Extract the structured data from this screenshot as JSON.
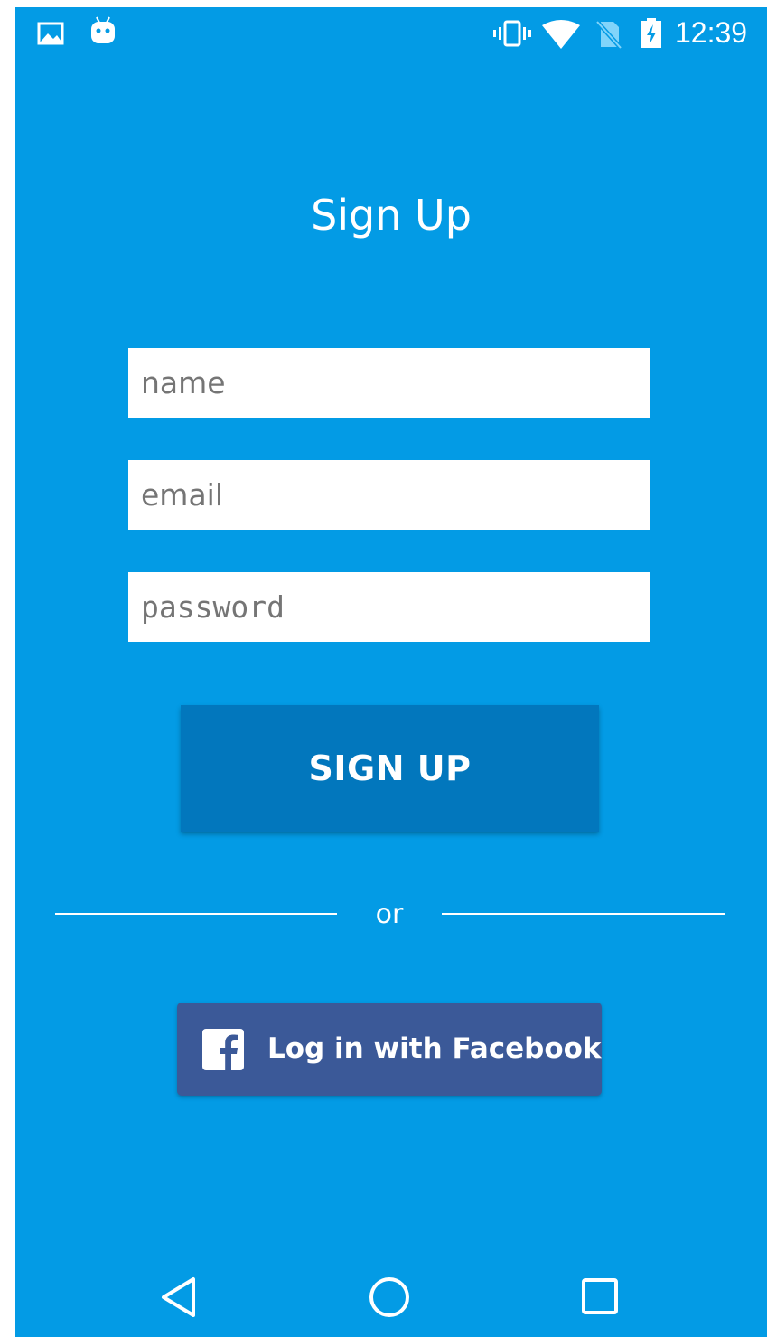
{
  "status_bar": {
    "time": "12:39",
    "icons": [
      "gallery-icon",
      "android-icon",
      "vibrate-icon",
      "wifi-icon",
      "no-sim-icon",
      "battery-charging-icon"
    ]
  },
  "page": {
    "title": "Sign Up"
  },
  "form": {
    "name_placeholder": "name",
    "email_placeholder": "email",
    "password_placeholder": "password",
    "signup_label": "SIGN UP"
  },
  "divider": {
    "text": "or"
  },
  "facebook": {
    "label": "Log in with Facebook",
    "icon": "facebook-icon"
  },
  "nav_bar": {
    "buttons": [
      "back-icon",
      "home-icon",
      "recents-icon"
    ]
  },
  "colors": {
    "background": "#039BE5",
    "signup_button": "#0277BD",
    "facebook_button": "#3B5998",
    "field_background": "#FFFFFF"
  }
}
